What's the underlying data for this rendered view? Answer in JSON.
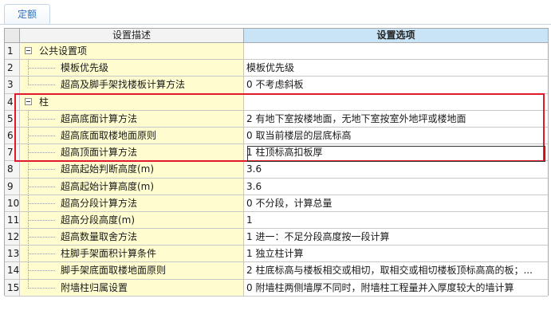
{
  "tab": {
    "label": "定额"
  },
  "header": {
    "desc": "设置描述",
    "opt": "设置选项"
  },
  "rows": [
    {
      "num": "1",
      "desc": "公共设置项",
      "opt": "",
      "type": "group"
    },
    {
      "num": "2",
      "desc": "模板优先级",
      "opt": "模板优先级",
      "type": "child"
    },
    {
      "num": "3",
      "desc": "超高及脚手架找楼板计算方法",
      "opt": "0 不考虑斜板",
      "type": "child-last"
    },
    {
      "num": "4",
      "desc": "柱",
      "opt": "",
      "type": "group"
    },
    {
      "num": "5",
      "desc": "超高底面计算方法",
      "opt": "2 有地下室按楼地面，无地下室按室外地坪或楼地面",
      "type": "child"
    },
    {
      "num": "6",
      "desc": "超高底面取楼地面原则",
      "opt": "0 取当前楼层的层底标高",
      "type": "child"
    },
    {
      "num": "7",
      "desc": "超高顶面计算方法",
      "opt": "1 柱顶标高扣板厚",
      "type": "child"
    },
    {
      "num": "8",
      "desc": "超高起始判断高度(m)",
      "opt": "3.6",
      "type": "child"
    },
    {
      "num": "9",
      "desc": "超高起始计算高度(m)",
      "opt": "3.6",
      "type": "child"
    },
    {
      "num": "10",
      "desc": "超高分段计算方法",
      "opt": "0 不分段，计算总量",
      "type": "child"
    },
    {
      "num": "11",
      "desc": "超高分段高度(m)",
      "opt": "1",
      "type": "child"
    },
    {
      "num": "12",
      "desc": "超高数量取舍方法",
      "opt": "1 进一：不足分段高度按一段计算",
      "type": "child"
    },
    {
      "num": "13",
      "desc": "柱脚手架面积计算条件",
      "opt": "1 独立柱计算",
      "type": "child"
    },
    {
      "num": "14",
      "desc": "脚手架底面取楼地面原则",
      "opt": "2 柱底标高与楼板相交或相切，取相交或相切楼板顶标高高的板；...",
      "type": "child"
    },
    {
      "num": "15",
      "desc": "附墙柱归属设置",
      "opt": "0 附墙柱两侧墙厚不同时，附墙柱工程量并入厚度较大的墙计算",
      "type": "child-last"
    }
  ],
  "icons": {
    "expander": "collapse-minus-icon"
  },
  "colors": {
    "desc_bg": "#fffdd0",
    "header_opt_bg": "#c9e4f7",
    "highlight_border": "#e01a2a"
  }
}
